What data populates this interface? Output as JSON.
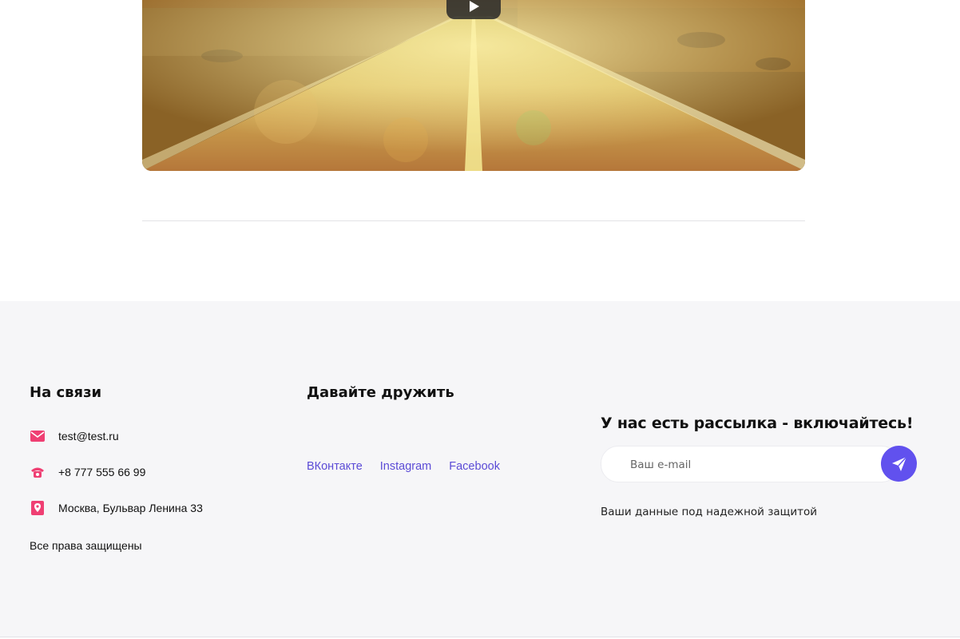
{
  "video": {
    "play_icon": "play-icon"
  },
  "footer": {
    "contacts": {
      "title": "На связи",
      "email": "test@test.ru",
      "phone": "+8 777 555 66 99",
      "address": "Москва, Бульвар Ленина 33",
      "rights": "Все права защищены",
      "icon_color": "#ef3f73",
      "icons": [
        "mail-icon",
        "phone-icon",
        "location-icon"
      ]
    },
    "social": {
      "title": "Давайте дружить",
      "links": [
        "ВКонтакте",
        "Instagram",
        "Facebook"
      ],
      "link_color": "#5b4bd6"
    },
    "newsletter": {
      "title": "У нас есть рассылка - включайтесь!",
      "email_placeholder": "Ваш e-mail",
      "note": "Ваши данные под надежной защитой",
      "button_color": "#6151ee",
      "button_icon": "send-icon"
    }
  }
}
